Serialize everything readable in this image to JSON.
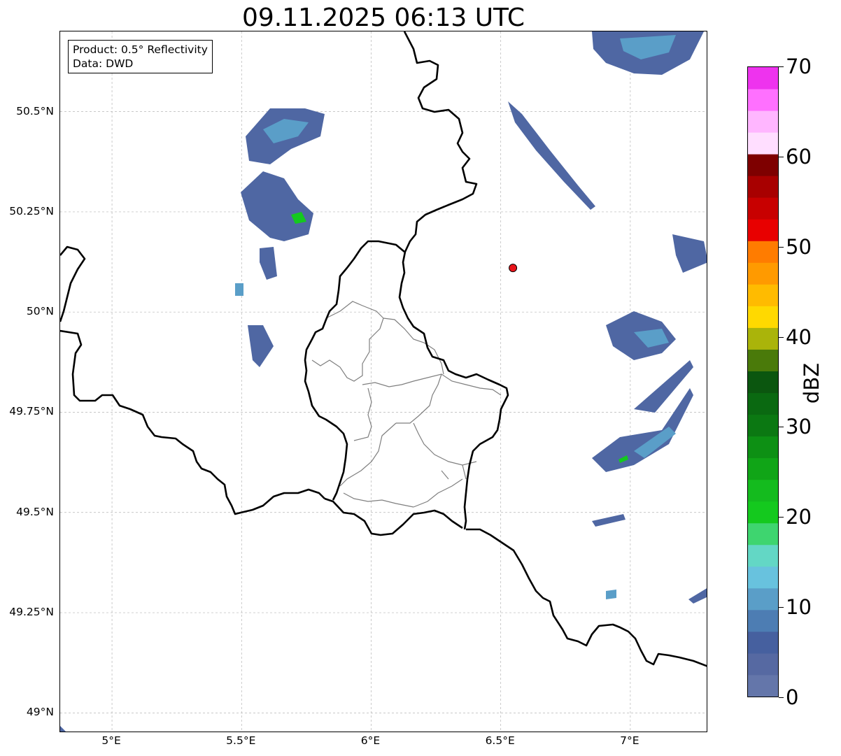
{
  "title": "09.11.2025 06:13 UTC",
  "info": {
    "product": "Product: 0.5° Reflectivity",
    "data": "Data: DWD"
  },
  "axes": {
    "lon_range": [
      4.8,
      7.3
    ],
    "lat_range": [
      48.95,
      50.7
    ],
    "x_ticks": [
      {
        "value": 5.0,
        "label": "5°E"
      },
      {
        "value": 5.5,
        "label": "5.5°E"
      },
      {
        "value": 6.0,
        "label": "6°E"
      },
      {
        "value": 6.5,
        "label": "6.5°E"
      },
      {
        "value": 7.0,
        "label": "7°E"
      }
    ],
    "y_ticks": [
      {
        "value": 50.5,
        "label": "50.5°N"
      },
      {
        "value": 50.25,
        "label": "50.25°N"
      },
      {
        "value": 50.0,
        "label": "50°N"
      },
      {
        "value": 49.75,
        "label": "49.75°N"
      },
      {
        "value": 49.5,
        "label": "49.5°N"
      },
      {
        "value": 49.25,
        "label": "49.25°N"
      },
      {
        "value": 49.0,
        "label": "49°N"
      }
    ],
    "grid": true
  },
  "radar_site": {
    "lon": 6.547,
    "lat": 50.11,
    "color": "#e8141b"
  },
  "colorbar": {
    "label": "dBZ",
    "range": [
      0,
      70
    ],
    "ticks": [
      {
        "value": 0,
        "label": "0"
      },
      {
        "value": 10,
        "label": "10"
      },
      {
        "value": 20,
        "label": "20"
      },
      {
        "value": 30,
        "label": "30"
      },
      {
        "value": 40,
        "label": "40"
      },
      {
        "value": 50,
        "label": "50"
      },
      {
        "value": 60,
        "label": "60"
      },
      {
        "value": 70,
        "label": "70"
      }
    ],
    "colors": [
      "#6476aa",
      "#5669a2",
      "#46609f",
      "#4d7db3",
      "#5a9ec8",
      "#68c2de",
      "#63d7c5",
      "#3ed56f",
      "#14c91e",
      "#14bb1e",
      "#10a517",
      "#0d9014",
      "#0b7812",
      "#0a6911",
      "#0b560f",
      "#4a7a0a",
      "#aab40a",
      "#ffd900",
      "#ffbb00",
      "#ff9a00",
      "#ff7c00",
      "#e80000",
      "#c80000",
      "#a80000",
      "#7e0000",
      "#ffdeff",
      "#ffb6ff",
      "#ff70ff",
      "#ee33ee"
    ]
  }
}
